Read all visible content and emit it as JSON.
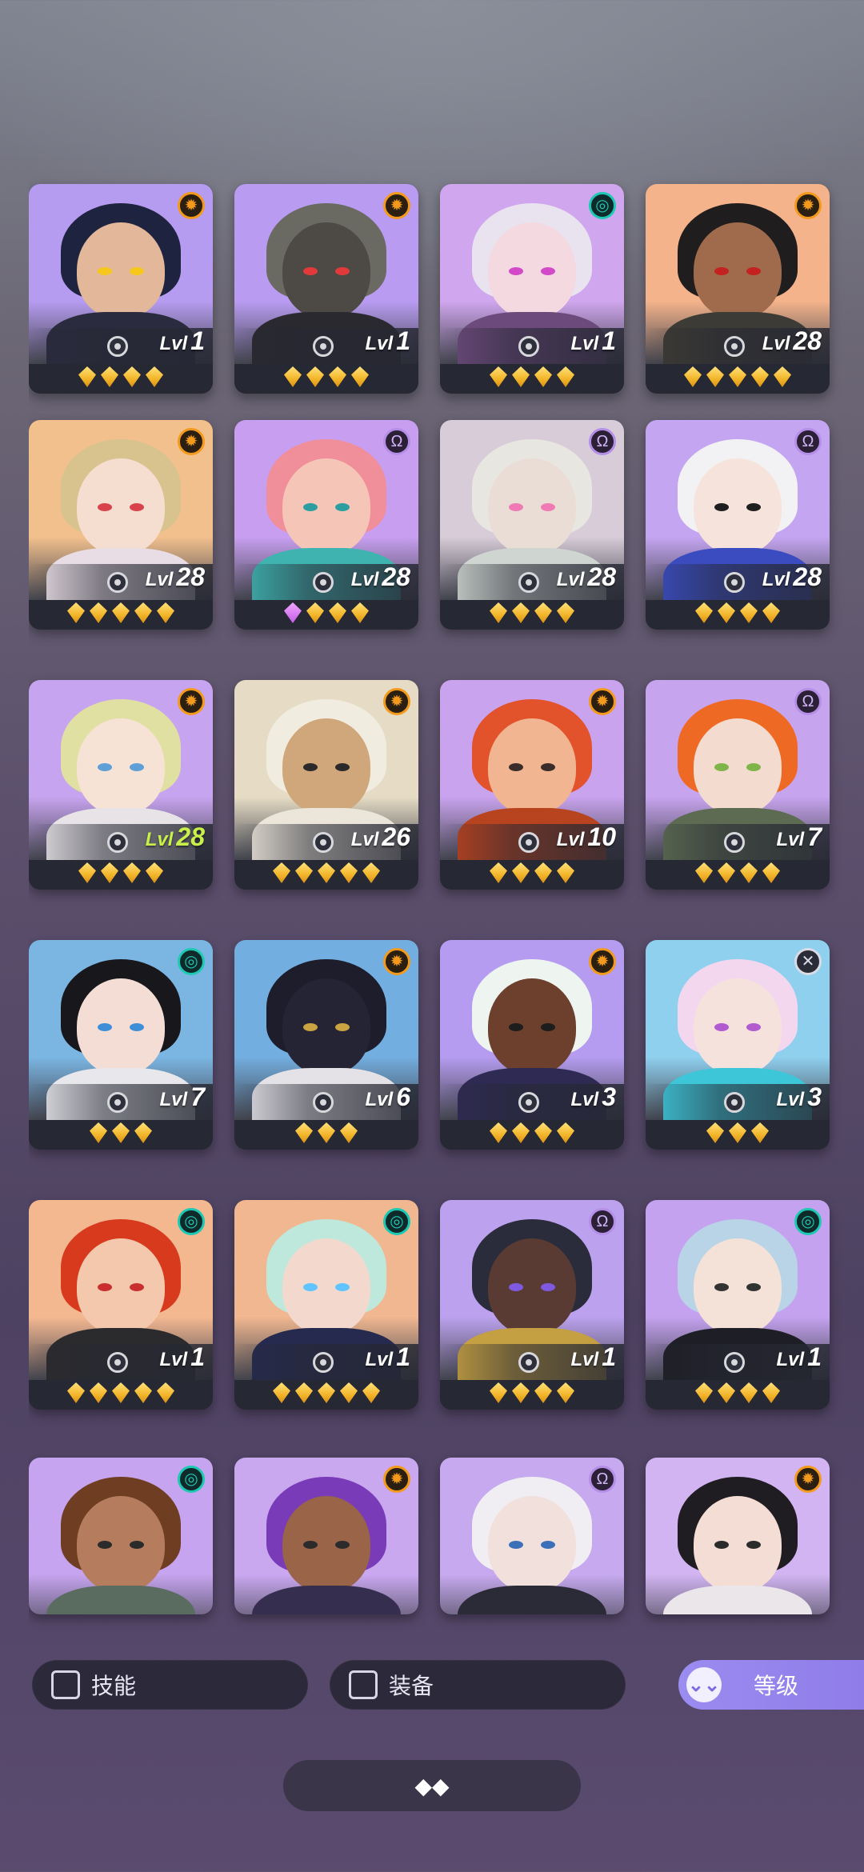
{
  "heroes": [
    {
      "level_prefix": "Lvl",
      "level": "1",
      "badge": "sun",
      "stars": 4,
      "colors": {
        "bg": "#b69cf0",
        "hair": "#1e2340",
        "skin": "#e3b79a",
        "body": "#2a2b3e",
        "eye": "#f6c81b"
      }
    },
    {
      "level_prefix": "Lvl",
      "level": "1",
      "badge": "sun",
      "stars": 4,
      "colors": {
        "bg": "#b99cf2",
        "hair": "#6a6a62",
        "skin": "#4d4a45",
        "body": "#2a2930",
        "eye": "#e23a3a"
      }
    },
    {
      "level_prefix": "Lvl",
      "level": "1",
      "badge": "swirl",
      "stars": 4,
      "colors": {
        "bg": "#d0a6ee",
        "hair": "#e8e3ee",
        "skin": "#f4d9e0",
        "body": "#6c4a7c",
        "eye": "#d34ac8"
      }
    },
    {
      "level_prefix": "Lvl",
      "level": "28",
      "badge": "sun",
      "stars": 5,
      "colors": {
        "bg": "#f4b38b",
        "hair": "#1f1d1e",
        "skin": "#a06a4c",
        "body": "#3d3b35",
        "eye": "#c42121"
      }
    },
    {
      "level_prefix": "Lvl",
      "level": "28",
      "badge": "sun",
      "stars": 5,
      "colors": {
        "bg": "#f2c08d",
        "hair": "#d8c28e",
        "skin": "#f5ddd0",
        "body": "#e8dde4",
        "eye": "#d8434b"
      }
    },
    {
      "level_prefix": "Lvl",
      "level": "28",
      "badge": "omega",
      "stars": 4,
      "pink_first": true,
      "colors": {
        "bg": "#c89ff0",
        "hair": "#f08e9a",
        "skin": "#f5c6b8",
        "body": "#3fb3b0",
        "eye": "#2b9fa0"
      }
    },
    {
      "level_prefix": "Lvl",
      "level": "28",
      "badge": "omega",
      "stars": 4,
      "colors": {
        "bg": "#d7ccd8",
        "hair": "#e8e6e1",
        "skin": "#eaddd6",
        "body": "#cfd5d0",
        "eye": "#ef7ab4"
      }
    },
    {
      "level_prefix": "Lvl",
      "level": "28",
      "badge": "omega",
      "stars": 4,
      "colors": {
        "bg": "#c4a5f1",
        "hair": "#f2f2f4",
        "skin": "#f6e4dc",
        "body": "#3a4cbf",
        "eye": "#1f1f1f"
      }
    },
    {
      "level_prefix": "Lvl",
      "level": "28",
      "badge": "sun",
      "stars": 4,
      "highlight": true,
      "colors": {
        "bg": "#c7a4ef",
        "hair": "#dfe0a2",
        "skin": "#f7e2d6",
        "body": "#e7e3e6",
        "eye": "#5f9fd8"
      }
    },
    {
      "level_prefix": "Lvl",
      "level": "26",
      "badge": "sun",
      "stars": 5,
      "colors": {
        "bg": "#e6dcc5",
        "hair": "#f1ece0",
        "skin": "#cfa77a",
        "body": "#ece6da",
        "eye": "#2a2a2a"
      }
    },
    {
      "level_prefix": "Lvl",
      "level": "10",
      "badge": "sun",
      "stars": 4,
      "colors": {
        "bg": "#c9a3ee",
        "hair": "#e2532b",
        "skin": "#f2b592",
        "body": "#b8431f",
        "eye": "#3a2d2a"
      }
    },
    {
      "level_prefix": "Lvl",
      "level": "7",
      "badge": "omega",
      "stars": 4,
      "colors": {
        "bg": "#c7a4ee",
        "hair": "#ee6a24",
        "skin": "#f3dccf",
        "body": "#5c6b52",
        "eye": "#7fb548"
      }
    },
    {
      "level_prefix": "Lvl",
      "level": "7",
      "badge": "swirl",
      "stars": 3,
      "colors": {
        "bg": "#7bb6e3",
        "hair": "#17171c",
        "skin": "#f3ddd5",
        "body": "#e7e7ec",
        "eye": "#3f8fd8"
      }
    },
    {
      "level_prefix": "Lvl",
      "level": "6",
      "badge": "sun",
      "stars": 3,
      "colors": {
        "bg": "#73aee0",
        "hair": "#1d1d2b",
        "skin": "#252435",
        "body": "#e4e2e7",
        "eye": "#caa441"
      }
    },
    {
      "level_prefix": "Lvl",
      "level": "3",
      "badge": "sun",
      "stars": 4,
      "colors": {
        "bg": "#b59cf0",
        "hair": "#eef4f0",
        "skin": "#6d3f2d",
        "body": "#2f2a54",
        "eye": "#1d1d1d"
      }
    },
    {
      "level_prefix": "Lvl",
      "level": "3",
      "badge": "cross",
      "stars": 3,
      "colors": {
        "bg": "#8fd0ef",
        "hair": "#f3d7ee",
        "skin": "#f6e2dc",
        "body": "#3dc6d8",
        "eye": "#b25ad0"
      }
    },
    {
      "level_prefix": "Lvl",
      "level": "1",
      "badge": "swirl",
      "stars": 5,
      "colors": {
        "bg": "#f4b891",
        "hair": "#d83a1e",
        "skin": "#f3c8ad",
        "body": "#2b2b2e",
        "eye": "#c92f2f"
      }
    },
    {
      "level_prefix": "Lvl",
      "level": "1",
      "badge": "swirl",
      "stars": 5,
      "colors": {
        "bg": "#f0b790",
        "hair": "#bfe8dd",
        "skin": "#f2d8cd",
        "body": "#262a4e",
        "eye": "#5fc4ff"
      }
    },
    {
      "level_prefix": "Lvl",
      "level": "1",
      "badge": "omega",
      "stars": 4,
      "colors": {
        "bg": "#bca2ee",
        "hair": "#2a2c3c",
        "skin": "#5a3b33",
        "body": "#c4a042",
        "eye": "#7f5ae0"
      }
    },
    {
      "level_prefix": "Lvl",
      "level": "1",
      "badge": "swirl",
      "stars": 4,
      "colors": {
        "bg": "#c4a2ef",
        "hair": "#b9d4e6",
        "skin": "#f4e1d7",
        "body": "#1e1e26",
        "eye": "#333333"
      }
    },
    {
      "level_prefix": "",
      "level": "",
      "badge": "swirl",
      "stars": 0,
      "partial": true,
      "colors": {
        "bg": "#c6a4ef",
        "hair": "#6e3d22",
        "skin": "#b57c5d",
        "body": "#5a6b5f",
        "eye": "#2b2b2b"
      }
    },
    {
      "level_prefix": "",
      "level": "",
      "badge": "sun",
      "stars": 0,
      "partial": true,
      "colors": {
        "bg": "#c9a8f0",
        "hair": "#7a3bb8",
        "skin": "#9a6448",
        "body": "#352e4e",
        "eye": "#2b2b2b"
      }
    },
    {
      "level_prefix": "",
      "level": "",
      "badge": "omega",
      "stars": 0,
      "partial": true,
      "colors": {
        "bg": "#c6a9ef",
        "hair": "#f1eef3",
        "skin": "#f2e0dc",
        "body": "#2a2b36",
        "eye": "#3b6fb8"
      }
    },
    {
      "level_prefix": "",
      "level": "",
      "badge": "sun",
      "stars": 0,
      "partial": true,
      "colors": {
        "bg": "#d1b4f1",
        "hair": "#1f1c22",
        "skin": "#f3ddd4",
        "body": "#eae6ea",
        "eye": "#2b2b2b"
      }
    }
  ],
  "filters": {
    "skill_label": "技能",
    "equip_label": "装备",
    "sort_label": "等级"
  },
  "icons": {
    "badge_sun": "sun-class-icon",
    "badge_omega": "omega-class-icon",
    "badge_swirl": "swirl-class-icon",
    "badge_cross": "cross-class-icon",
    "gear": "gear-icon",
    "sort": "double-chevron-down-icon",
    "collapse": "diamond-cluster-icon"
  }
}
